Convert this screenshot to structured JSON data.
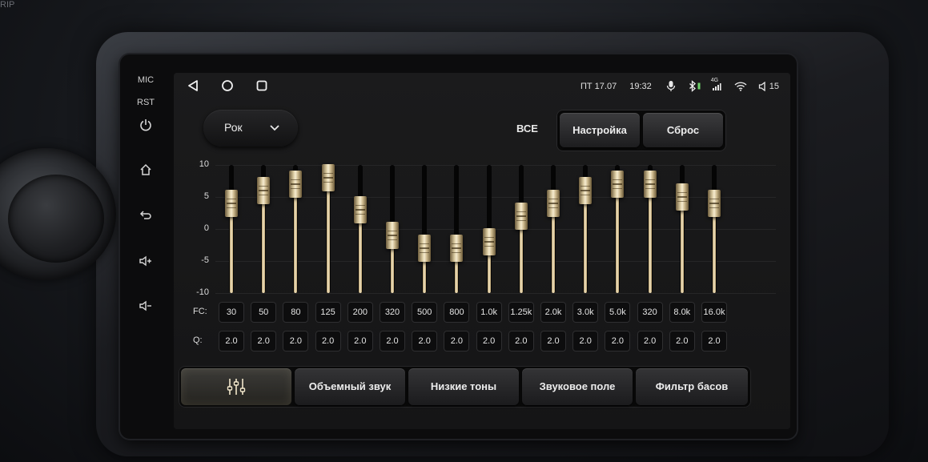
{
  "bezel": {
    "top_left_text": "RIP",
    "mic_label": "MIC",
    "rst_label": "RST",
    "buttons": [
      {
        "name": "power-icon"
      },
      {
        "name": "home-icon"
      },
      {
        "name": "back-icon"
      },
      {
        "name": "volume-up-icon"
      },
      {
        "name": "volume-down-icon"
      }
    ]
  },
  "status": {
    "nav_buttons": [
      "back-triangle-icon",
      "home-circle-icon",
      "recents-square-icon"
    ],
    "day_date": "ПТ 17.07",
    "time": "19:32",
    "network": "4G",
    "volume": "15",
    "icons": [
      "microphone-icon",
      "bluetooth-icon",
      "signal-icon",
      "wifi-icon",
      "volume-icon"
    ]
  },
  "toolbar": {
    "preset": "Рок",
    "all_label": "ВСЕ",
    "settings_label": "Настройка",
    "reset_label": "Сброс"
  },
  "equalizer": {
    "y_ticks": [
      "10",
      "5",
      "0",
      "-5",
      "-10"
    ],
    "y_range": [
      -10,
      10
    ],
    "fc_label": "FC:",
    "q_label": "Q:",
    "bands": [
      {
        "fc": "30",
        "q": "2.0",
        "gain": 4
      },
      {
        "fc": "50",
        "q": "2.0",
        "gain": 6
      },
      {
        "fc": "80",
        "q": "2.0",
        "gain": 7
      },
      {
        "fc": "125",
        "q": "2.0",
        "gain": 8
      },
      {
        "fc": "200",
        "q": "2.0",
        "gain": 3
      },
      {
        "fc": "320",
        "q": "2.0",
        "gain": -1
      },
      {
        "fc": "500",
        "q": "2.0",
        "gain": -3
      },
      {
        "fc": "800",
        "q": "2.0",
        "gain": -3
      },
      {
        "fc": "1.0k",
        "q": "2.0",
        "gain": -2
      },
      {
        "fc": "1.25k",
        "q": "2.0",
        "gain": 2
      },
      {
        "fc": "2.0k",
        "q": "2.0",
        "gain": 4
      },
      {
        "fc": "3.0k",
        "q": "2.0",
        "gain": 6
      },
      {
        "fc": "5.0k",
        "q": "2.0",
        "gain": 7
      },
      {
        "fc": "320",
        "q": "2.0",
        "gain": 7
      },
      {
        "fc": "8.0k",
        "q": "2.0",
        "gain": 5
      },
      {
        "fc": "16.0k",
        "q": "2.0",
        "gain": 4
      }
    ]
  },
  "tabs": {
    "eq_icon": "equalizer-sliders-icon",
    "surround": "Объемный звук",
    "bass": "Низкие тоны",
    "sound_field": "Звуковое поле",
    "bass_filter": "Фильтр басов"
  },
  "colors": {
    "slider_gold": "#e6d5ad",
    "screen_bg": "#1b1b1c",
    "bluetooth_green": "#6fd36a"
  }
}
